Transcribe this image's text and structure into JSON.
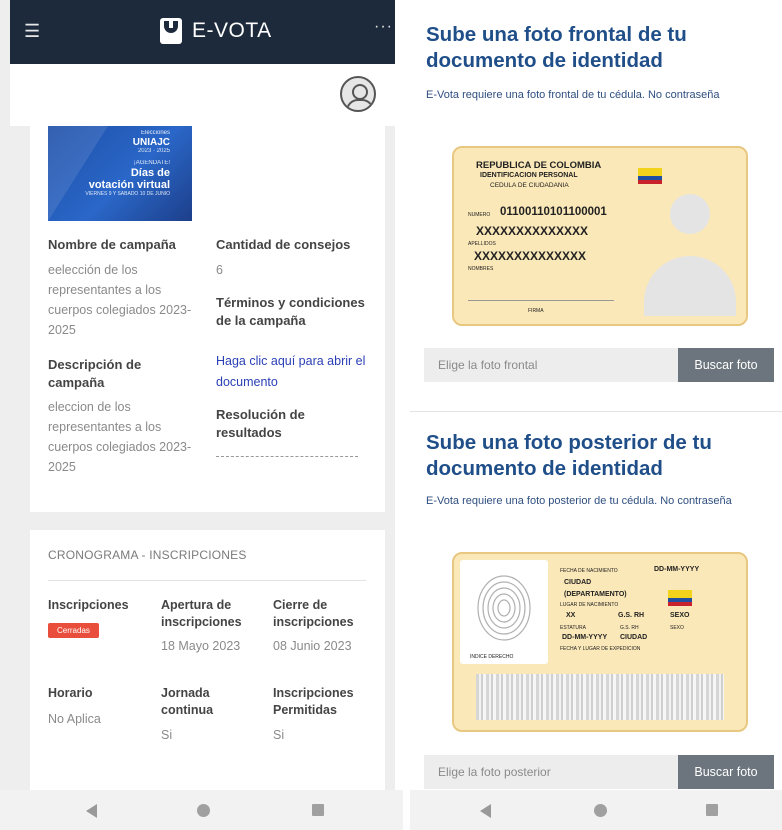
{
  "app": {
    "name": "E-VOTA"
  },
  "header": {
    "menu_icon": "☰",
    "more_icon": "···"
  },
  "banner": {
    "line1": "Elecciones",
    "line2": "UNIAJC",
    "line3": "2023 · 2025",
    "line4": "¡AGENDATE!",
    "line5": "Días de",
    "line6": "votación virtual",
    "line7": "VIERNES 9 Y SABADO 10 DE JUNIO"
  },
  "campaign": {
    "name_label": "Nombre de campaña",
    "name_value": "eelección de los representantes a los cuerpos colegiados 2023-2025",
    "description_label": "Descripción de campaña",
    "description_value": "eleccion de los representantes a los cuerpos colegiados 2023-2025",
    "council_count_label": "Cantidad de consejos",
    "council_count_value": "6",
    "terms_label": "Términos y condiciones de la campaña",
    "terms_link": "Haga clic aquí para abrir el documento",
    "results_label": "Resolución de resultados"
  },
  "schedule": {
    "title": "CRONOGRAMA - INSCRIPCIONES",
    "registration_label": "Inscripciones",
    "registration_status": "Cerradas",
    "opening_label": "Apertura de inscripciones",
    "opening_value": "18 Mayo 2023",
    "closing_label": "Cierre de inscripciones",
    "closing_value": "08 Junio 2023",
    "schedule_label": "Horario",
    "schedule_value": "No Aplica",
    "continuous_label": "Jornada continua",
    "continuous_value": "Si",
    "allowed_label": "Inscripciones Permitidas",
    "allowed_value": "Si"
  },
  "front_upload": {
    "title": "Sube una foto frontal de tu documento de identidad",
    "subtitle": "E-Vota requiere una foto frontal de tu cédula. No contraseña",
    "placeholder": "Elige la foto frontal",
    "button": "Buscar foto"
  },
  "back_upload": {
    "title": "Sube una foto posterior de tu documento de identidad",
    "subtitle": "E-Vota requiere una foto posterior de tu cédula. No contraseña",
    "placeholder": "Elige la foto posterior",
    "button": "Buscar foto"
  },
  "front_card": {
    "country": "REPUBLICA DE COLOMBIA",
    "doc_type": "IDENTIFICACION PERSONAL",
    "doc_name": "CEDULA DE CIUDADANIA",
    "number_label": "NUMERO",
    "number": "01100110101100001",
    "x_line1": "XXXXXXXXXXXXXX",
    "surnames_label": "APELLIDOS",
    "x_line2": "XXXXXXXXXXXXXX",
    "names_label": "NOMBRES",
    "signature_label": "FIRMA"
  },
  "back_card": {
    "birth_date_label": "FECHA DE NACIMIENTO",
    "birth_date": "DD-MM-YYYY",
    "city": "CIUDAD",
    "department": "(DEPARTAMENTO)",
    "birth_place_label": "LUGAR DE NACIMIENTO",
    "height": "XX",
    "blood": "G.S. RH",
    "sex": "SEXO",
    "height_label": "ESTATURA",
    "blood_label": "G.S. RH",
    "sex_label": "SEXO",
    "issue_date": "DD-MM-YYYY",
    "issue_city": "CIUDAD",
    "issue_label": "FECHA Y LUGAR DE EXPEDICION",
    "finger_label": "INDICE DERECHO"
  },
  "colors": {
    "topbar": "#1c2a3b",
    "title_blue": "#1f4e89",
    "link": "#2a3fb6",
    "badge_red": "#e94e3c",
    "button_gray": "#6c757d",
    "card_bg": "#fbe8b8"
  },
  "icons": {
    "menu": "hamburger-icon",
    "more": "more-icon",
    "avatar": "user-avatar-icon",
    "back": "nav-back-icon",
    "home": "nav-home-icon",
    "recent": "nav-recent-icon"
  }
}
